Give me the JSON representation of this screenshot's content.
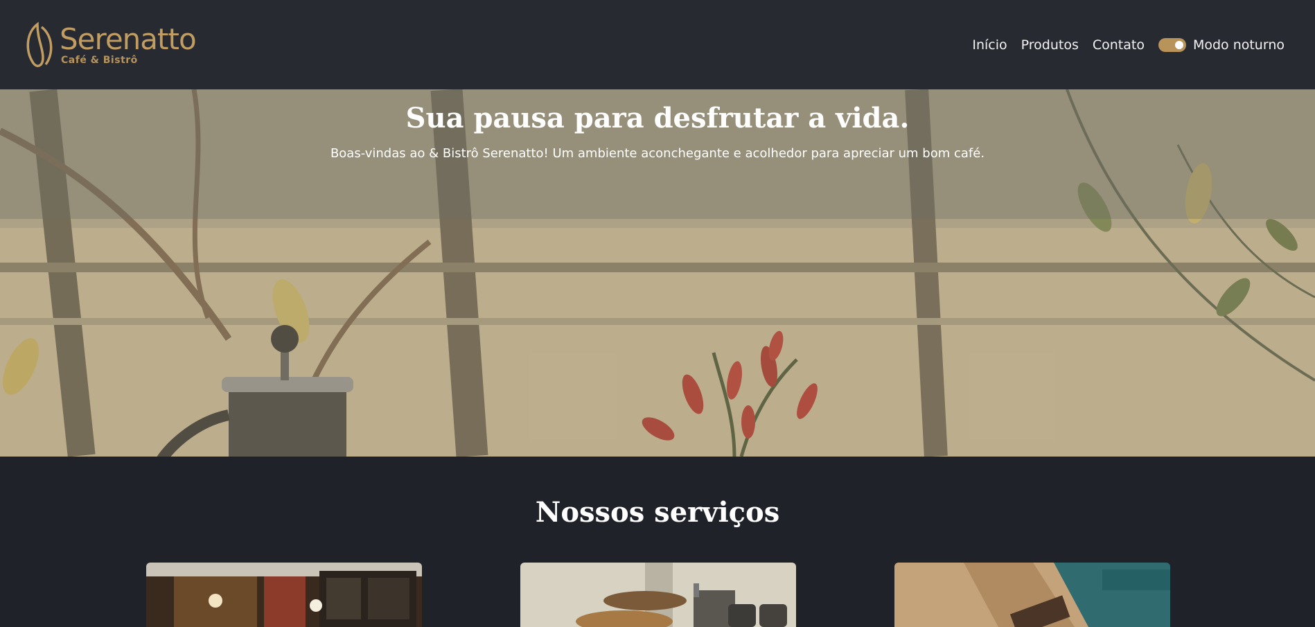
{
  "brand": {
    "name": "Serenatto",
    "subtitle": "Café & Bistrô",
    "mark_icon": "coffee-bean-logo"
  },
  "nav": {
    "items": [
      "Início",
      "Produtos",
      "Contato"
    ],
    "toggle_label": "Modo noturno",
    "toggle_on": true
  },
  "hero": {
    "title": "Sua pausa para desfrutar a vida.",
    "text": "Boas-vindas ao & Bistrô Serenatto! Um ambiente aconchegante e acolhedor para apreciar um bom café."
  },
  "services": {
    "title": "Nossos serviços"
  },
  "colors": {
    "header_bg": "#272b31",
    "page_bg": "#1f2329",
    "accent": "#b8935a"
  }
}
